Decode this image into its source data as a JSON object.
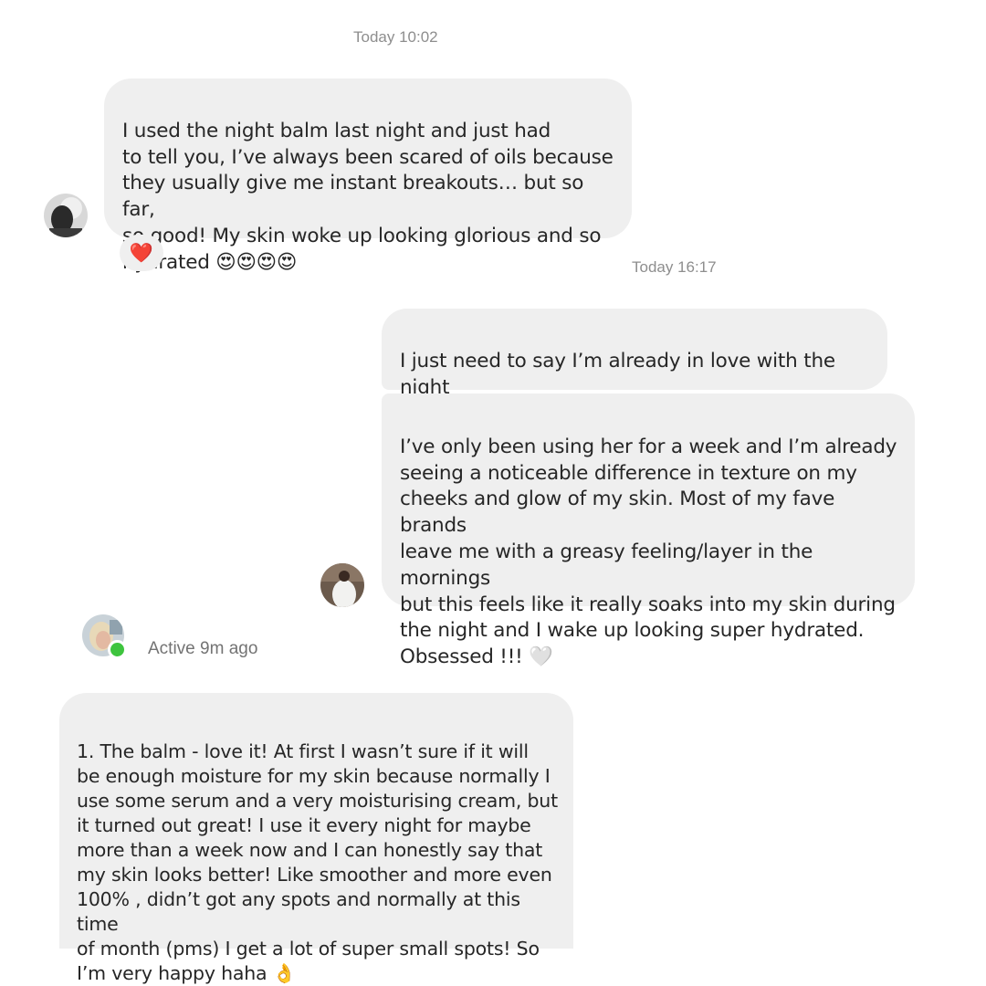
{
  "timestamps": {
    "first": "Today 10:02",
    "second": "Today 16:17"
  },
  "messages": [
    {
      "text": "I used the night balm last night and just had\nto tell you, I’ve always been scared of oils because\nthey usually give me instant breakouts… but so far,\nso good! My skin woke up looking glorious and so\nhydrated 😍😍😍😍",
      "reaction": "❤️"
    },
    {
      "text": "I just need to say I’m already in love with the night\nbalm."
    },
    {
      "text": "I’ve only been using her for a week and I’m already\nseeing a noticeable difference in texture on my\ncheeks and glow of my skin. Most of my fave brands\nleave me with a greasy feeling/layer in the mornings\nbut this feels like it really soaks into my skin during\nthe night and I wake up looking super hydrated.\nObsessed !!! 🤍"
    },
    {
      "text": "1. The balm - love it! At first I wasn’t sure if it will\nbe enough moisture for my skin because normally I\nuse some serum and a very moisturising cream, but\nit turned out great! I use it every night for maybe\nmore than a week now and I can honestly say that\nmy skin looks better! Like smoother and more even\n100% , didn’t got any spots and normally at this time\nof month (pms) I get a lot of super small spots! So\nI’m very happy haha 👌"
    }
  ],
  "status": {
    "active_text": "Active 9m ago",
    "online_color": "#3ec43e"
  },
  "icons": {
    "reaction": "heart-icon",
    "online": "online-indicator-icon"
  }
}
